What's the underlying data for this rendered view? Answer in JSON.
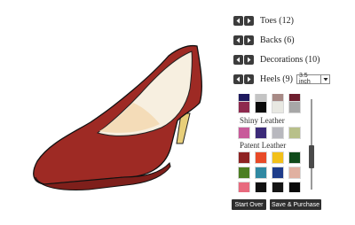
{
  "options": [
    {
      "label": "Toes (12)"
    },
    {
      "label": "Backs (6)"
    },
    {
      "label": "Decorations (10)"
    },
    {
      "label": "Heels (9)"
    }
  ],
  "heel_height": {
    "selected": "3.5 inch"
  },
  "swatches": {
    "top_partial": [
      "#1e1a5e",
      "#c4c4c4",
      "#a88a86",
      "#6e1e2e"
    ],
    "top_row": [
      "#8e2a4e",
      "#0a0a0a",
      "#e8e8e2",
      "#a7a7a7"
    ],
    "shiny_leather": {
      "label": "Shiny Leather",
      "colors": [
        "#c85a9a",
        "#3b2a78",
        "#b8b8be",
        "#b8c08a"
      ]
    },
    "patent_leather": {
      "label": "Patent Leather",
      "rows": [
        [
          "#8e2323",
          "#e84a28",
          "#f2c01a",
          "#0f4a1a"
        ],
        [
          "#4c7e22",
          "#3088a2",
          "#1e3c8a",
          "#e0b0a0"
        ],
        [
          "#e86a7e",
          "#101010",
          "#141414",
          "#0a0a0a"
        ]
      ]
    }
  },
  "buttons": {
    "start_over": "Start Over",
    "save_purchase": "Save & Purchase"
  },
  "colors": {
    "shoe": "#9e2a24",
    "lining": "#f7efe0",
    "heel": "#e8cf7a"
  }
}
